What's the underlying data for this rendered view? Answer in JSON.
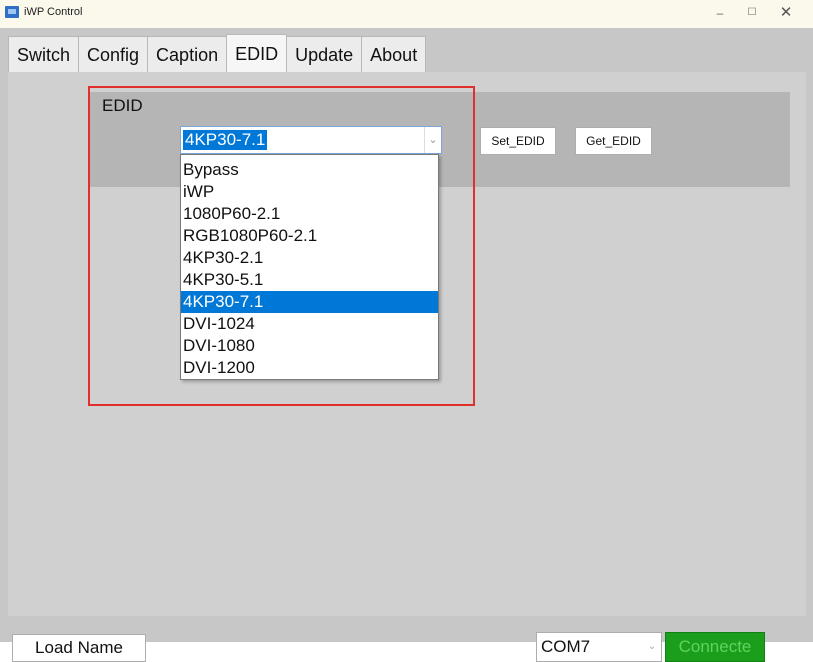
{
  "window": {
    "title": "iWP Control",
    "controls": {
      "minimize": "–",
      "maximize": "☐",
      "close": "✕"
    }
  },
  "tabs": [
    {
      "label": "Switch"
    },
    {
      "label": "Config"
    },
    {
      "label": "Caption"
    },
    {
      "label": "EDID",
      "active": true
    },
    {
      "label": "Update"
    },
    {
      "label": "About"
    }
  ],
  "edid_group": {
    "label": "EDID",
    "combo_value": "4KP30-7.1",
    "combo_arrow": "⌄",
    "set_button": "Set_EDID",
    "get_button": "Get_EDID"
  },
  "dropdown": {
    "options": [
      "Bypass",
      "iWP",
      "1080P60-2.1",
      "RGB1080P60-2.1",
      "4KP30-2.1",
      "4KP30-5.1",
      "4KP30-7.1",
      "DVI-1024",
      "DVI-1080",
      "DVI-1200"
    ],
    "selected": "4KP30-7.1"
  },
  "bottom": {
    "load_name": "Load Name",
    "com_port": "COM7",
    "com_arrow": "⌄",
    "connect_label": "Connecte"
  },
  "colors": {
    "highlight_border": "#e0302c",
    "selection": "#0078d7",
    "connect_bg": "#1b9e1b"
  }
}
